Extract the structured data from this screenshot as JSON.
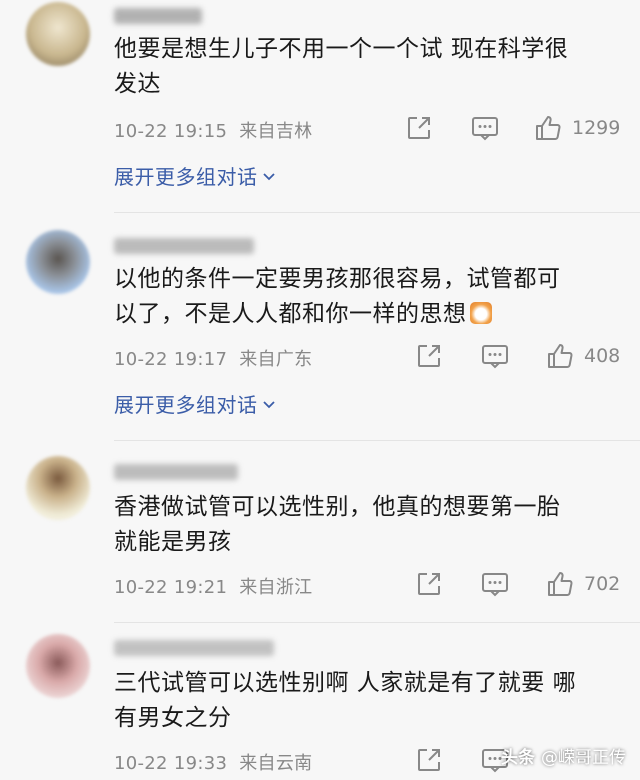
{
  "comments": [
    {
      "text_line1": "他要是想生儿子不用一个一个试 现在科学很",
      "text_line2": "发达",
      "time": "10-22 19:15",
      "location": "来自吉林",
      "likes": "1299",
      "expand": "展开更多组对话",
      "avatar_color": "#d8c9a8"
    },
    {
      "text_line1": "以他的条件一定要男孩那很容易，试管都可",
      "text_line2": "以了，不是人人都和你一样的思想",
      "time": "10-22 19:17",
      "location": "来自广东",
      "likes": "408",
      "expand": "展开更多组对话",
      "avatar_color": "#9bb4d6"
    },
    {
      "text_line1": "香港做试管可以选性别，他真的想要第一胎",
      "text_line2": "就能是男孩",
      "time": "10-22 19:21",
      "location": "来自浙江",
      "likes": "702",
      "avatar_color": "#e8e2c8"
    },
    {
      "text_line1": "三代试管可以选性别啊 人家就是有了就要 哪",
      "text_line2": "有男女之分",
      "time": "10-22 19:33",
      "location": "来自云南",
      "avatar_color": "#e3c6c6"
    }
  ],
  "watermark": {
    "platform": "头条",
    "author": "@嵘哥正传"
  },
  "colors": {
    "link": "#3b5da8",
    "meta": "#888888",
    "background": "#f7f7f7"
  }
}
